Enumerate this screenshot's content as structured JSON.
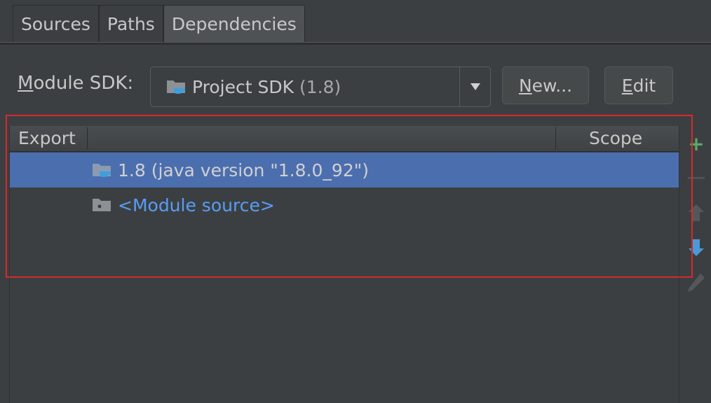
{
  "tabs": [
    {
      "label": "Sources",
      "active": false
    },
    {
      "label": "Paths",
      "active": false
    },
    {
      "label": "Dependencies",
      "active": true
    }
  ],
  "module_sdk": {
    "label_mnemonic": "M",
    "label_rest": "odule SDK:",
    "selected_name": "Project SDK",
    "selected_version": "(1.8)",
    "icon": "sdk-folder-icon"
  },
  "buttons": {
    "new_mnemonic": "N",
    "new_rest": "ew...",
    "edit_mnemonic": "E",
    "edit_rest": "dit"
  },
  "table": {
    "columns": [
      "Export",
      "Scope"
    ],
    "rows": [
      {
        "label": "1.8 (java version \"1.8.0_92\")",
        "icon": "sdk-folder-icon",
        "selected": true
      },
      {
        "label": "<Module source>",
        "icon": "module-folder-icon",
        "selected": false
      }
    ]
  },
  "toolbar": [
    "add-icon",
    "remove-icon",
    "move-up-icon",
    "move-down-icon",
    "edit-pencil-icon"
  ],
  "colors": {
    "background": "#3c3f41",
    "selection": "#4b6eaf",
    "link": "#589df6",
    "add": "#59a869",
    "highlight_box": "#d42a2a"
  }
}
